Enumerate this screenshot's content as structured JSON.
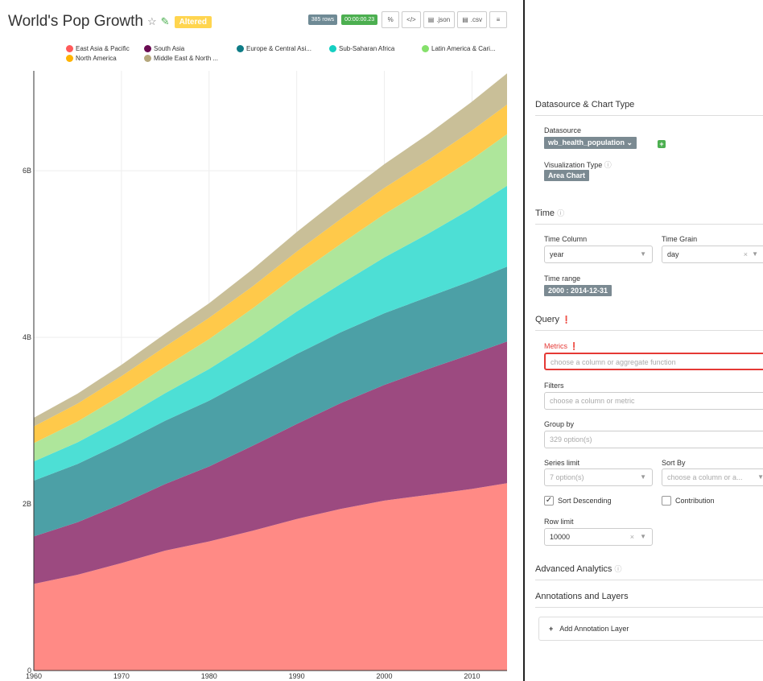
{
  "header": {
    "title": "World's Pop Growth",
    "altered_badge": "Altered",
    "rows_badge": "385 rows",
    "time_badge": "00:00:00.23",
    "json_label": ".json",
    "csv_label": ".csv"
  },
  "chart_data": {
    "type": "area",
    "stacked": true,
    "title": "World's Pop Growth",
    "x": [
      1960,
      1965,
      1970,
      1975,
      1980,
      1985,
      1990,
      1995,
      2000,
      2005,
      2010,
      2014
    ],
    "x_ticks": [
      "1960",
      "1970",
      "1980",
      "1990",
      "2000",
      "2010"
    ],
    "y_ticks": [
      "0",
      "2B",
      "4B",
      "6B"
    ],
    "ylim": [
      0,
      7200000000
    ],
    "xlim": [
      1960,
      2014
    ],
    "legend_position": "top",
    "series": [
      {
        "name": "East Asia & Pacific",
        "color": "#ff8a85",
        "values": [
          1040000000,
          1150000000,
          1290000000,
          1440000000,
          1550000000,
          1680000000,
          1820000000,
          1940000000,
          2040000000,
          2110000000,
          2180000000,
          2250000000
        ]
      },
      {
        "name": "South Asia",
        "color": "#9c4a80",
        "values": [
          570000000,
          630000000,
          710000000,
          800000000,
          900000000,
          1020000000,
          1140000000,
          1270000000,
          1390000000,
          1510000000,
          1620000000,
          1700000000
        ]
      },
      {
        "name": "Europe & Central Asia",
        "color": "#4ca0a6",
        "values": [
          670000000,
          700000000,
          730000000,
          760000000,
          790000000,
          820000000,
          840000000,
          850000000,
          860000000,
          865000000,
          880000000,
          900000000
        ]
      },
      {
        "name": "Sub-Saharan Africa",
        "color": "#4ddfd5",
        "values": [
          230000000,
          260000000,
          290000000,
          330000000,
          380000000,
          430000000,
          510000000,
          580000000,
          670000000,
          760000000,
          870000000,
          970000000
        ]
      },
      {
        "name": "Latin America & Caribbean",
        "color": "#aee69b",
        "values": [
          220000000,
          250000000,
          285000000,
          320000000,
          360000000,
          400000000,
          440000000,
          480000000,
          520000000,
          555000000,
          590000000,
          620000000
        ]
      },
      {
        "name": "North America",
        "color": "#ffc94a",
        "values": [
          200000000,
          215000000,
          230000000,
          240000000,
          255000000,
          265000000,
          280000000,
          300000000,
          315000000,
          330000000,
          345000000,
          355000000
        ]
      },
      {
        "name": "Middle East & North Africa",
        "color": "#c9bf98",
        "values": [
          105000000,
          120000000,
          135000000,
          155000000,
          175000000,
          205000000,
          235000000,
          260000000,
          285000000,
          310000000,
          345000000,
          375000000
        ]
      }
    ]
  },
  "legend": [
    {
      "label": "East Asia & Pacific",
      "color": "#ff5a5a"
    },
    {
      "label": "South Asia",
      "color": "#6a0b52"
    },
    {
      "label": "Europe & Central Asi...",
      "color": "#0e7c86"
    },
    {
      "label": "Sub-Saharan Africa",
      "color": "#15cfc2"
    },
    {
      "label": "Latin America & Cari...",
      "color": "#85e06b"
    },
    {
      "label": "North America",
      "color": "#ffb300"
    },
    {
      "label": "Middle East & North ...",
      "color": "#b5a77c"
    }
  ],
  "panel": {
    "datasource_section": "Datasource & Chart Type",
    "datasource_label": "Datasource",
    "datasource_value": "wb_health_population",
    "viz_type_label": "Visualization Type",
    "viz_type_value": "Area Chart",
    "time_section": "Time",
    "time_column_label": "Time Column",
    "time_column_value": "year",
    "time_grain_label": "Time Grain",
    "time_grain_value": "day",
    "time_range_label": "Time range",
    "time_range_value": "2000 : 2014-12-31",
    "query_section": "Query",
    "metrics_label": "Metrics",
    "metrics_placeholder": "choose a column or aggregate function",
    "filters_label": "Filters",
    "filters_placeholder": "choose a column or metric",
    "group_by_label": "Group by",
    "group_by_placeholder": "329 option(s)",
    "series_limit_label": "Series limit",
    "series_limit_placeholder": "7 option(s)",
    "sort_by_label": "Sort By",
    "sort_by_placeholder": "choose a column or a...",
    "sort_desc_label": "Sort Descending",
    "sort_desc_checked": true,
    "contribution_label": "Contribution",
    "contribution_checked": false,
    "row_limit_label": "Row limit",
    "row_limit_value": "10000",
    "advanced_section": "Advanced Analytics",
    "annotations_section": "Annotations and Layers",
    "add_annotation_label": "Add Annotation Layer"
  }
}
